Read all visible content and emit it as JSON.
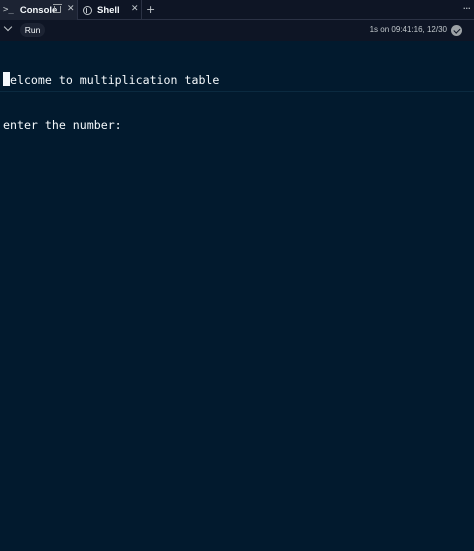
{
  "tabs": [
    {
      "label": "Console",
      "icon": "terminal-prompt-icon",
      "active": true
    },
    {
      "label": "Shell",
      "icon": "shell-icon",
      "active": false
    }
  ],
  "toolbar": {
    "run_label": "Run",
    "status_text": "1s on 09:41:16, 12/30"
  },
  "console": {
    "lines": [
      "welcome to multiplication table",
      "enter the number:"
    ]
  },
  "colors": {
    "background": "#0e1525",
    "console_background": "#021a2e",
    "tab_active": "#1c2333",
    "text": "#f5f9fc"
  }
}
